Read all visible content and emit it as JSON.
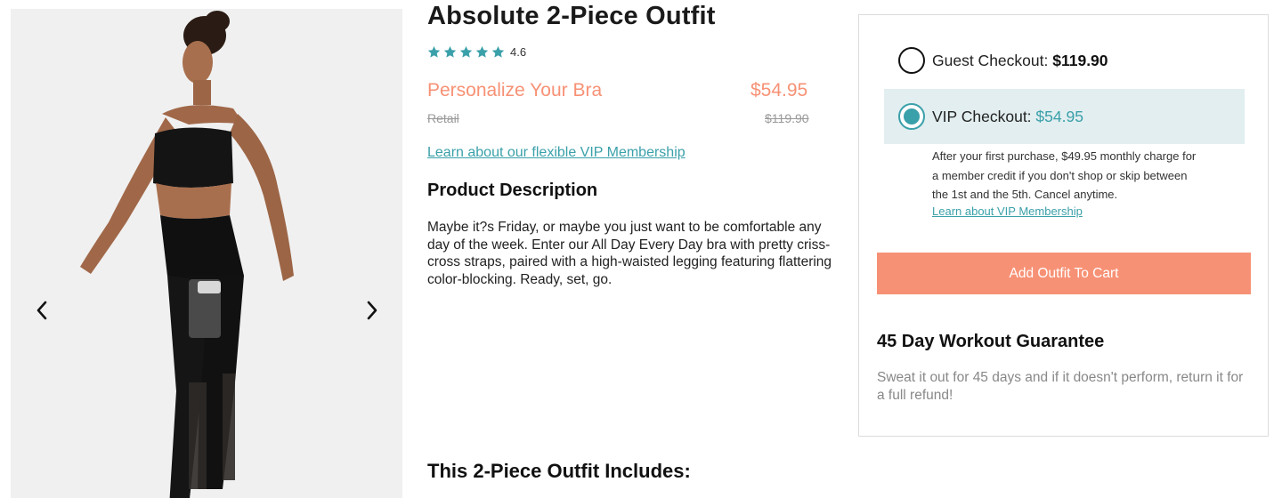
{
  "product": {
    "title": "Absolute 2-Piece Outfit",
    "rating": 4.6,
    "rating_label": "4.6",
    "star_count": 5,
    "personalize_label": "Personalize Your Bra",
    "vip_price": "$54.95",
    "retail_label": "Retail",
    "retail_price": "$119.90",
    "vip_membership_link": "Learn about our flexible VIP Membership",
    "description_heading": "Product Description",
    "description": "Maybe it?s Friday, or maybe you just want to be comfortable any day of the week. Enter our All Day Every Day bra with pretty criss-cross straps, paired with a high-waisted legging featuring flattering color-blocking. Ready, set, go.",
    "includes_heading": "This 2-Piece Outfit Includes:"
  },
  "gallery": {
    "prev_icon": "chevron-left-icon",
    "next_icon": "chevron-right-icon"
  },
  "checkout": {
    "guest_label": "Guest Checkout:",
    "guest_price": "$119.90",
    "vip_label": "VIP Checkout:",
    "vip_price": "$54.95",
    "selected": "vip",
    "vip_note": "After your first purchase, $49.95 monthly charge for a member credit if you don't shop or skip between the 1st and the 5th. Cancel anytime.",
    "vip_note_link": "Learn about VIP Membership",
    "add_button": "Add Outfit To Cart",
    "guarantee_title": "45 Day Workout Guarantee",
    "guarantee_body": "Sweat it out for 45 days and if it doesn't perform, return it for a full refund!"
  },
  "colors": {
    "accent_coral": "#f79175",
    "accent_teal": "#3aa0a9",
    "vip_box_bg": "#e2eef0",
    "star": "#3aa0a9"
  }
}
